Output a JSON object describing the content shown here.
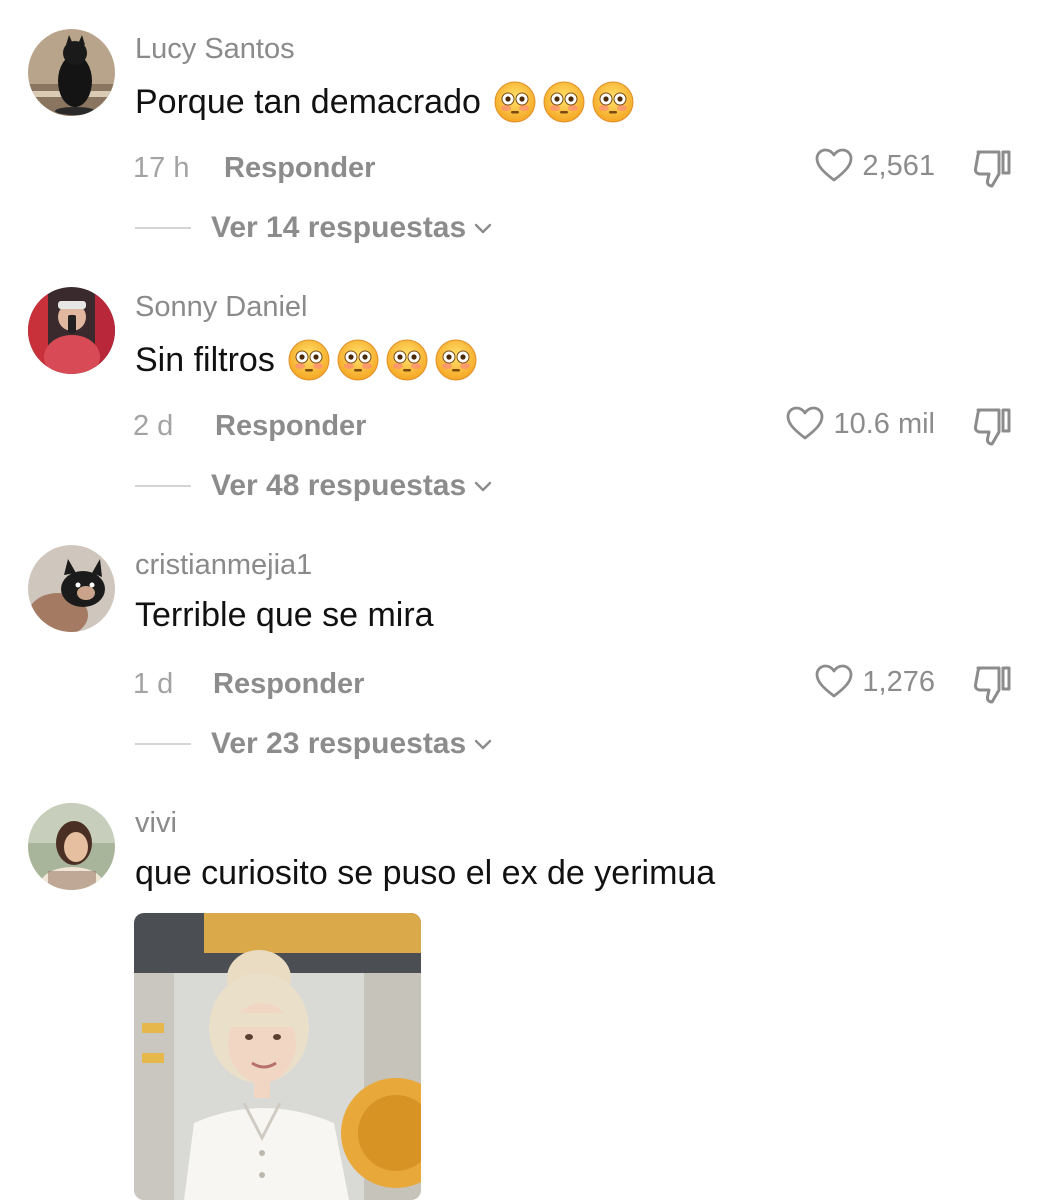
{
  "comments": [
    {
      "username": "Lucy Santos",
      "text": "Porque tan demacrado",
      "emojis": [
        "flushed-face-emoji",
        "flushed-face-emoji",
        "flushed-face-emoji"
      ],
      "time": "17 h",
      "reply_label": "Responder",
      "likes": "2,561",
      "replies_label": "Ver 14 respuestas"
    },
    {
      "username": "Sonny Daniel",
      "text": "Sin filtros",
      "emojis": [
        "flushed-face-emoji",
        "flushed-face-emoji",
        "flushed-face-emoji",
        "flushed-face-emoji"
      ],
      "time": "2 d",
      "reply_label": "Responder",
      "likes": "10.6 mil",
      "replies_label": "Ver 48 respuestas"
    },
    {
      "username": "cristianmejia1",
      "text": "Terrible que se mira",
      "emojis": [],
      "time": "1 d",
      "reply_label": "Responder",
      "likes": "1,276",
      "replies_label": "Ver 23 respuestas"
    },
    {
      "username": "vivi",
      "text": "que curiosito se puso el ex de yerimua",
      "has_gif": true
    }
  ],
  "icons": {
    "like": "heart-outline-icon",
    "dislike": "thumbs-down-icon",
    "expand": "chevron-down-icon"
  },
  "colors": {
    "username": "#8a8a8a",
    "meta": "#a3a3a3",
    "action": "#8c8c8c",
    "text": "#111111"
  }
}
